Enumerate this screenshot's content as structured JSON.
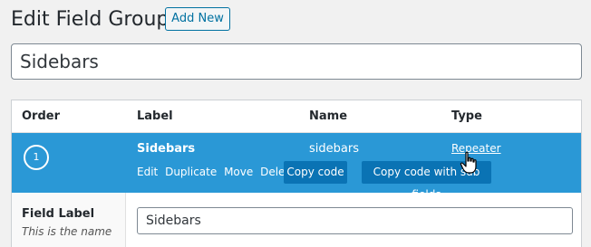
{
  "header": {
    "title": "Edit Field Group",
    "add_new_label": "Add New"
  },
  "group": {
    "title_value": "Sidebars"
  },
  "fields_table": {
    "columns": [
      "Order",
      "Label",
      "Name",
      "Type"
    ],
    "rows": [
      {
        "order": "1",
        "label": "Sidebars",
        "name": "sidebars",
        "type": "Repeater",
        "actions": [
          "Edit",
          "Duplicate",
          "Move",
          "Delete"
        ],
        "copy_code_label": "Copy code",
        "copy_code_sub_label": "Copy code with sub fields"
      }
    ]
  },
  "field_settings": {
    "field_label_title": "Field Label",
    "field_label_hint": "This is the name",
    "field_label_value": "Sidebars"
  },
  "colors": {
    "accent": "#2a98d6",
    "button": "#0a73b4",
    "link": "#0071a1"
  },
  "icons": {
    "cursor": "hand-pointer-icon"
  }
}
